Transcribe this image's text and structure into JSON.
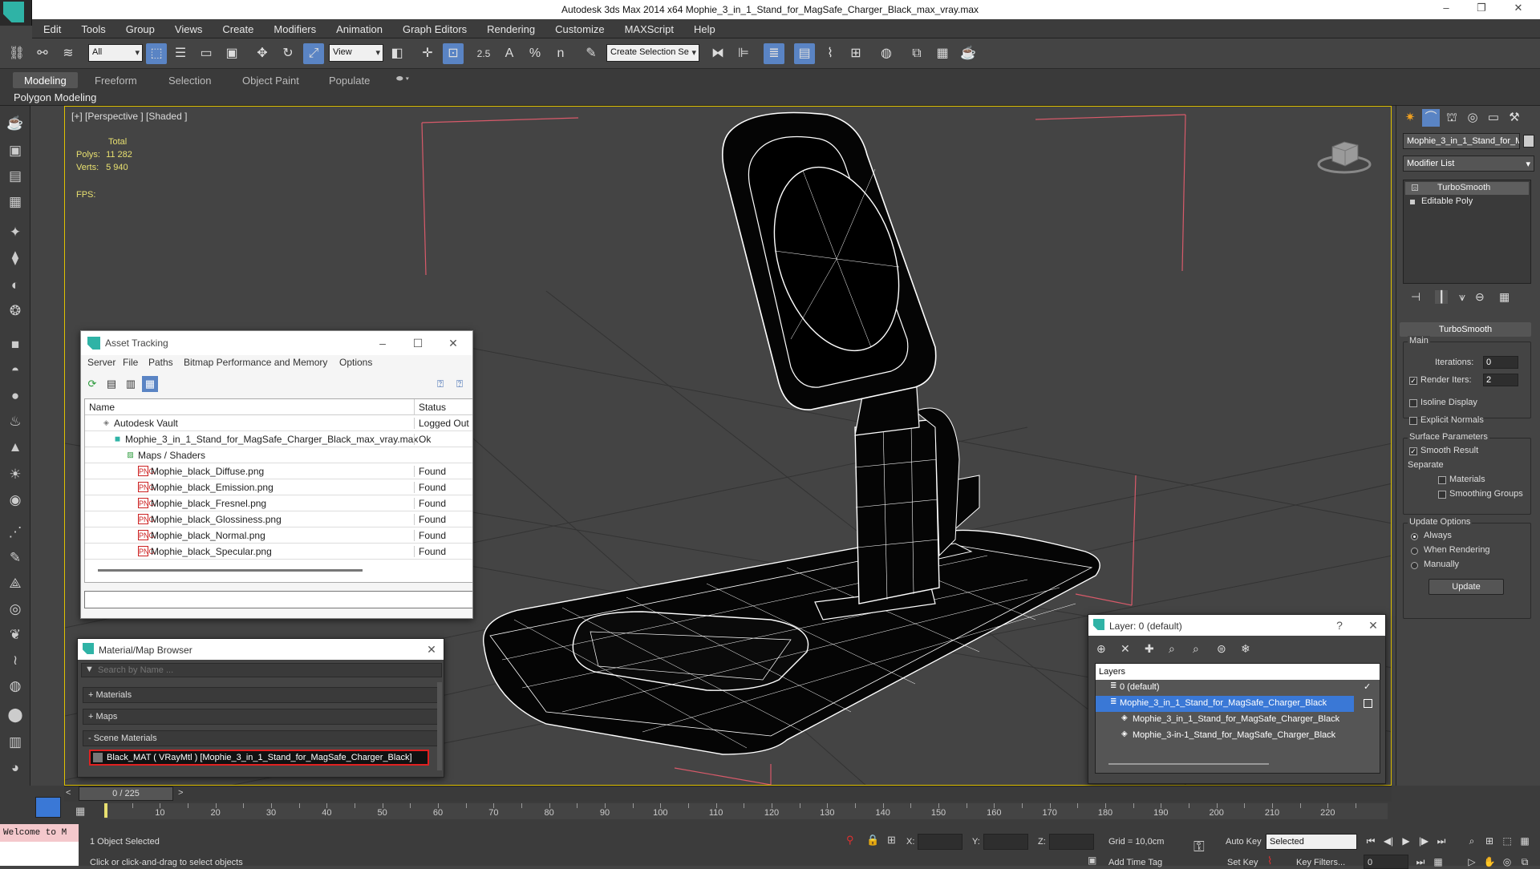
{
  "app": {
    "title": "Autodesk 3ds Max  2014 x64     Mophie_3_in_1_Stand_for_MagSafe_Charger_Black_max_vray.max",
    "window_buttons": [
      "–",
      "❐",
      "✕"
    ]
  },
  "menu": [
    "Edit",
    "Tools",
    "Group",
    "Views",
    "Create",
    "Modifiers",
    "Animation",
    "Graph Editors",
    "Rendering",
    "Customize",
    "MAXScript",
    "Help"
  ],
  "toolbar": {
    "selection_filter": "All",
    "ref_coord": "View",
    "selection_set": "Create Selection Se",
    "snap_labels": [
      "2.5",
      "A",
      "%",
      "n"
    ]
  },
  "ribbon": {
    "tabs": [
      "Modeling",
      "Freeform",
      "Selection",
      "Object Paint",
      "Populate"
    ],
    "active_tab": "Modeling",
    "sub_label": "Polygon Modeling"
  },
  "viewport": {
    "label": "[+] [Perspective ] [Shaded ]",
    "stats_header": "Total",
    "polys_label": "Polys:",
    "polys_value": "11 282",
    "verts_label": "Verts:",
    "verts_value": "5 940",
    "fps_label": "FPS:",
    "border_color": "#e0c200",
    "wire_color": "#ffffff",
    "mesh_fill": "#050505"
  },
  "asset_tracking": {
    "title": "Asset Tracking",
    "menu": [
      "Server",
      "File",
      "Paths",
      "Bitmap Performance and Memory",
      "Options"
    ],
    "col_name": "Name",
    "col_status": "Status",
    "rows": [
      {
        "name": "Autodesk Vault",
        "status": "Logged Out ."
      },
      {
        "name": "Mophie_3_in_1_Stand_for_MagSafe_Charger_Black_max_vray.max",
        "status": "Ok"
      },
      {
        "name": "Maps / Shaders",
        "status": ""
      },
      {
        "name": "Mophie_black_Diffuse.png",
        "status": "Found"
      },
      {
        "name": "Mophie_black_Emission.png",
        "status": "Found"
      },
      {
        "name": "Mophie_black_Fresnel.png",
        "status": "Found"
      },
      {
        "name": "Mophie_black_Glossiness.png",
        "status": "Found"
      },
      {
        "name": "Mophie_black_Normal.png",
        "status": "Found"
      },
      {
        "name": "Mophie_black_Specular.png",
        "status": "Found"
      }
    ],
    "icon_png": "PNG"
  },
  "material_browser": {
    "title": "Material/Map Browser",
    "search_placeholder": "Search by Name ...",
    "sections": [
      "+ Materials",
      "+ Maps",
      "- Scene Materials"
    ],
    "scene_material": "Black_MAT  ( VRayMtl )  [Mophie_3_in_1_Stand_for_MagSafe_Charger_Black]"
  },
  "layer_window": {
    "title": "Layer: 0 (default)",
    "help": "?",
    "header": "Layers",
    "rows": [
      {
        "name": "0 (default)"
      },
      {
        "name": "Mophie_3_in_1_Stand_for_MagSafe_Charger_Black"
      },
      {
        "name": "Mophie_3_in_1_Stand_for_MagSafe_Charger_Black"
      },
      {
        "name": "Mophie_3-in-1_Stand_for_MagSafe_Charger_Black"
      }
    ],
    "selected_color": "#3a78d6"
  },
  "command_panel": {
    "object_name": "Mophie_3_in_1_Stand_for_M",
    "modifier_list": "Modifier List",
    "stack": [
      "TurboSmooth",
      "Editable Poly"
    ],
    "rollout_title": "TurboSmooth",
    "main_label": "Main",
    "iterations_label": "Iterations:",
    "iterations_value": "0",
    "render_iters_label": "Render Iters:",
    "render_iters_value": "2",
    "isoline_label": "Isoline Display",
    "explicit_normals_label": "Explicit Normals",
    "surface_params_label": "Surface Parameters",
    "smooth_result_label": "Smooth Result",
    "separate_label": "Separate",
    "materials_label": "Materials",
    "smoothing_groups_label": "Smoothing Groups",
    "update_options_label": "Update Options",
    "always_label": "Always",
    "when_rendering_label": "When Rendering",
    "manually_label": "Manually",
    "update_button": "Update"
  },
  "timeline": {
    "frame_counter": "0 / 225",
    "ticks": [
      "10",
      "20",
      "30",
      "40",
      "50",
      "60",
      "70",
      "80",
      "90",
      "100",
      "110",
      "120",
      "130",
      "140",
      "150",
      "160",
      "170",
      "180",
      "190",
      "200",
      "210",
      "220"
    ]
  },
  "status": {
    "welcome": "Welcome to M",
    "selected": "1 Object Selected",
    "prompt": "Click or click-and-drag to select objects",
    "x_label": "X:",
    "y_label": "Y:",
    "z_label": "Z:",
    "grid": "Grid = 10,0cm",
    "add_time_tag": "Add Time Tag",
    "auto_key": "Auto Key",
    "set_key": "Set Key",
    "selected_dropdown": "Selected",
    "key_filters": "Key Filters...",
    "frame_field": "0"
  }
}
